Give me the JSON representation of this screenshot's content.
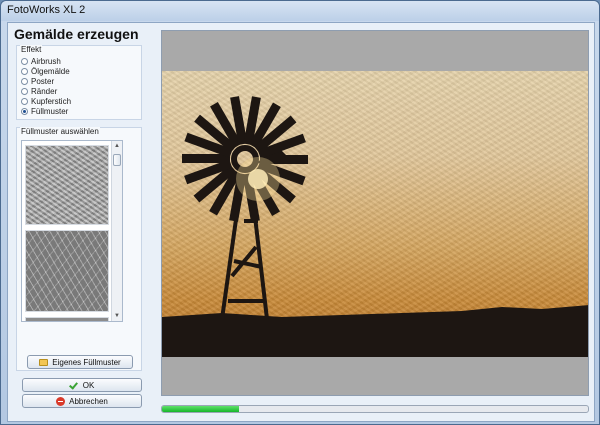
{
  "window": {
    "title": "FotoWorks XL 2"
  },
  "panel": {
    "heading": "Gemälde erzeugen",
    "effekt": {
      "label": "Effekt",
      "options": [
        {
          "label": "Airbrush",
          "checked": false
        },
        {
          "label": "Ölgemälde",
          "checked": false
        },
        {
          "label": "Poster",
          "checked": false
        },
        {
          "label": "Ränder",
          "checked": false
        },
        {
          "label": "Kupferstich",
          "checked": false
        },
        {
          "label": "Füllmuster",
          "checked": true
        }
      ]
    },
    "fuellmuster": {
      "label": "Füllmuster auswählen",
      "own_button": "Eigenes Füllmuster"
    }
  },
  "buttons": {
    "ok": "OK",
    "cancel": "Abbrechen"
  },
  "progress": {
    "value": 0.18
  },
  "icons": [
    "folder-icon",
    "check-icon",
    "cancel-icon",
    "scroll-up-icon",
    "scroll-down-icon"
  ]
}
